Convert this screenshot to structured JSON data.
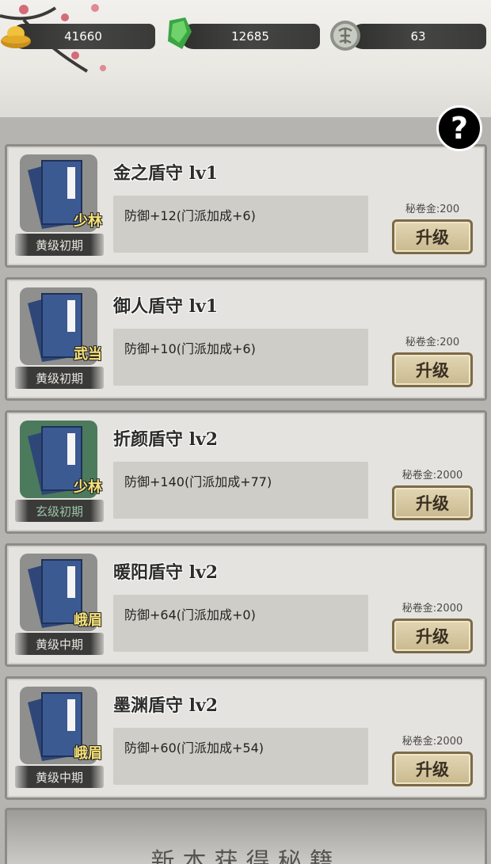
{
  "resources": {
    "gold": "41660",
    "jade": "12685",
    "coin": "63"
  },
  "help_label": "?",
  "skills": [
    {
      "name": "金之盾守 lv1",
      "sect": "少林",
      "grade": "黄级初期",
      "effect": "防御+12(门派加成+6)",
      "cost": "秘卷金:200",
      "button": "升级",
      "box_color": "gray"
    },
    {
      "name": "御人盾守 lv1",
      "sect": "武当",
      "grade": "黄级初期",
      "effect": "防御+10(门派加成+6)",
      "cost": "秘卷金:200",
      "button": "升级",
      "box_color": "gray"
    },
    {
      "name": "折颜盾守 lv2",
      "sect": "少林",
      "grade": "玄级初期",
      "effect": "防御+140(门派加成+77)",
      "cost": "秘卷金:2000",
      "button": "升级",
      "box_color": "green"
    },
    {
      "name": "暖阳盾守 lv2",
      "sect": "峨眉",
      "grade": "黄级中期",
      "effect": "防御+64(门派加成+0)",
      "cost": "秘卷金:2000",
      "button": "升级",
      "box_color": "gray"
    },
    {
      "name": "墨渊盾守 lv2",
      "sect": "峨眉",
      "grade": "黄级中期",
      "effect": "防御+60(门派加成+54)",
      "cost": "秘卷金:2000",
      "button": "升级",
      "box_color": "gray"
    }
  ],
  "bottom_banner": "新本获得秘籍",
  "colors": {
    "card_bg": "#e4e3df",
    "button_bg": "#d8caa4",
    "sect_text": "#f7e27a",
    "book_blue": "#3c5a92"
  }
}
